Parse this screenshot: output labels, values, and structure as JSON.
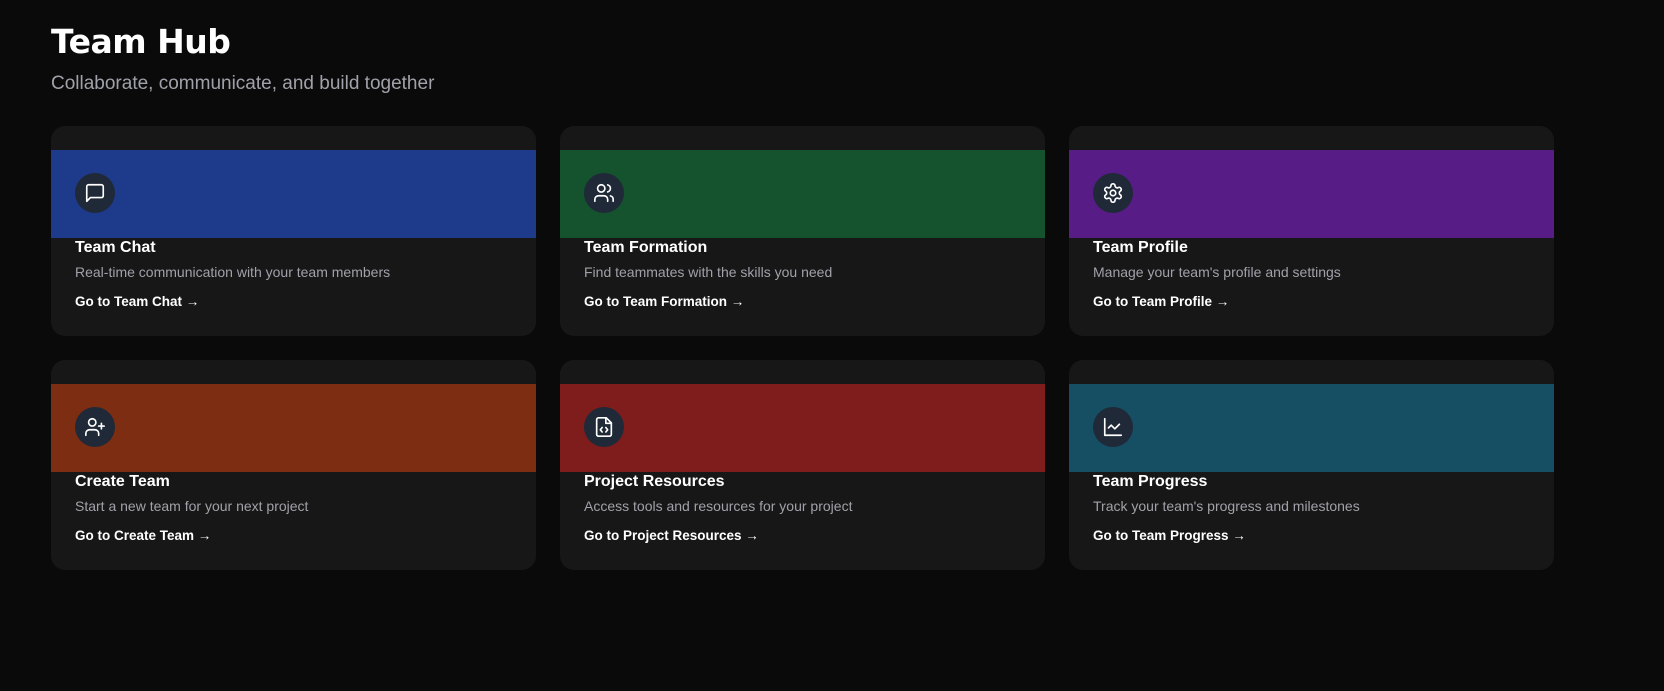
{
  "header": {
    "title": "Team Hub",
    "subtitle": "Collaborate, communicate, and build together"
  },
  "cards": [
    {
      "title": "Team Chat",
      "description": "Real-time communication with your team members",
      "link": "Go to Team Chat →",
      "icon": "message-square-icon",
      "color": "#1e3a8a"
    },
    {
      "title": "Team Formation",
      "description": "Find teammates with the skills you need",
      "link": "Go to Team Formation →",
      "icon": "users-icon",
      "color": "#14532d"
    },
    {
      "title": "Team Profile",
      "description": "Manage your team's profile and settings",
      "link": "Go to Team Profile →",
      "icon": "settings-gear-icon",
      "color": "#581c87"
    },
    {
      "title": "Create Team",
      "description": "Start a new team for your next project",
      "link": "Go to Create Team →",
      "icon": "user-plus-icon",
      "color": "#7c2d12"
    },
    {
      "title": "Project Resources",
      "description": "Access tools and resources for your project",
      "link": "Go to Project Resources →",
      "icon": "file-code-icon",
      "color": "#7f1d1d"
    },
    {
      "title": "Team Progress",
      "description": "Track your team's progress and milestones",
      "link": "Go to Team Progress →",
      "icon": "line-chart-icon",
      "color": "#164e63"
    }
  ]
}
